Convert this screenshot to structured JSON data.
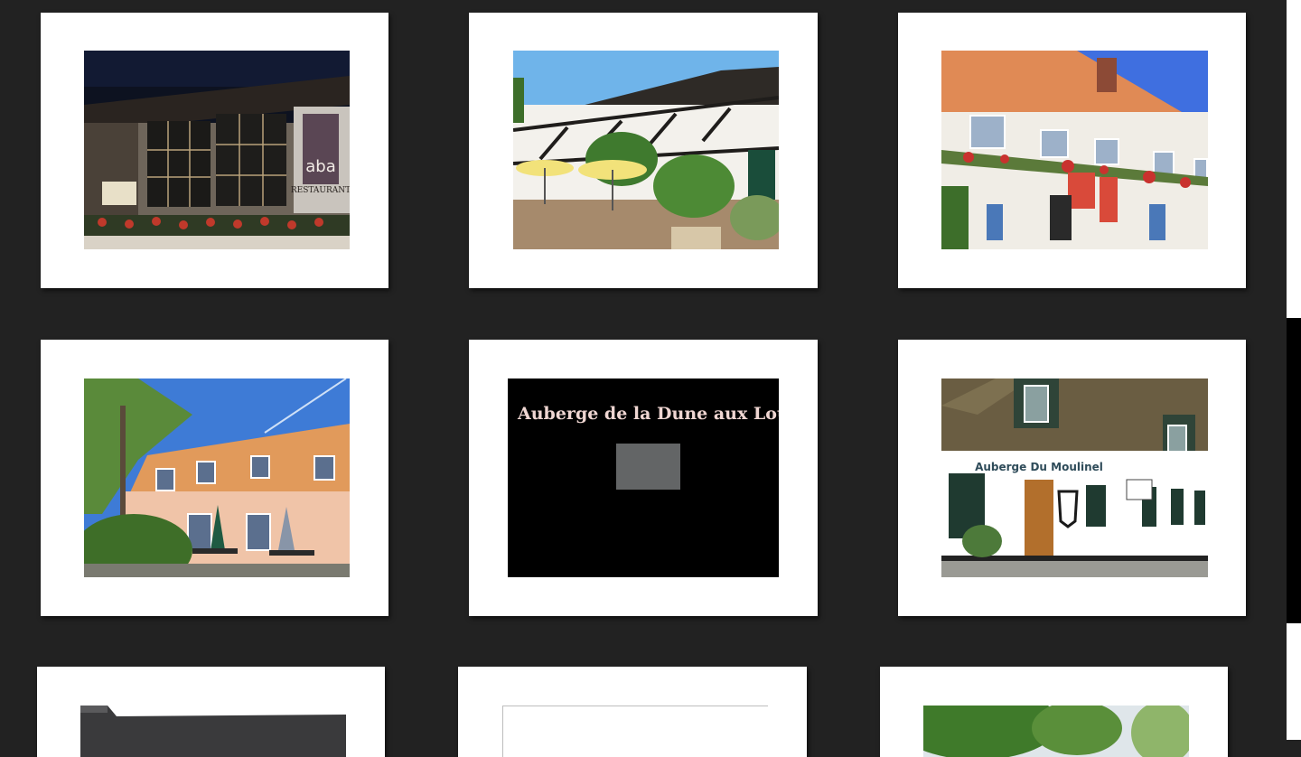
{
  "gallery": {
    "items": [
      {
        "id": "aba-restaurant",
        "sign_text": "aba",
        "sign_sub": "RESTAURANT"
      },
      {
        "id": "half-timbered-inn"
      },
      {
        "id": "ivy-manor"
      },
      {
        "id": "pink-hotel-terrace"
      },
      {
        "id": "dune-aux-loups",
        "caption": "Auberge de la Dune aux Loups"
      },
      {
        "id": "auberge-du-moulinel",
        "sign_text": "Auberge Du Moulinel"
      },
      {
        "id": "slate-roof-partial"
      },
      {
        "id": "blank-partial"
      },
      {
        "id": "trees-partial"
      }
    ]
  },
  "colors": {
    "background": "#222222",
    "card": "#ffffff",
    "scrollbar_thumb": "#000000",
    "caption_text": "#efd6d2"
  }
}
